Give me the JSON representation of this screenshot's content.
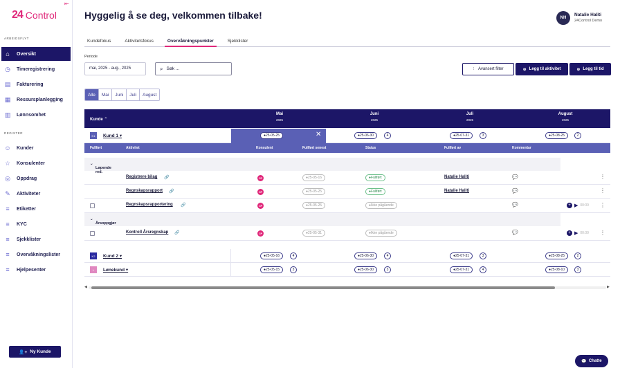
{
  "app": {
    "logo_mark": "24",
    "logo_text": "Control"
  },
  "sidebar": {
    "section_work": "ARBEIDSFLYT",
    "section_register": "REGISTER",
    "work_items": [
      {
        "label": "Oversikt",
        "icon": "home-icon",
        "active": true
      },
      {
        "label": "Timeregistrering",
        "icon": "clock-icon"
      },
      {
        "label": "Fakturering",
        "icon": "invoice-icon"
      },
      {
        "label": "Ressursplanlegging",
        "icon": "calendar-icon"
      },
      {
        "label": "Lønnsomhet",
        "icon": "chart-icon"
      }
    ],
    "register_items": [
      {
        "label": "Kunder",
        "icon": "user-icon"
      },
      {
        "label": "Konsulenter",
        "icon": "star-icon"
      },
      {
        "label": "Oppdrag",
        "icon": "task-icon"
      },
      {
        "label": "Aktiviteter",
        "icon": "activity-icon"
      },
      {
        "label": "Etiketter",
        "icon": "tag-icon"
      },
      {
        "label": "KYC",
        "icon": "kyc-icon"
      },
      {
        "label": "Sjekklister",
        "icon": "checklist-icon"
      },
      {
        "label": "Overvåkningslister",
        "icon": "watchlist-icon"
      },
      {
        "label": "Hjelpesenter",
        "icon": "help-icon"
      }
    ],
    "new_customer": "Ny Kunde"
  },
  "header": {
    "greeting": "Hyggelig å se deg, velkommen tilbake!",
    "avatar": "NH",
    "user_name": "Natalie Haliti",
    "user_org": "24Control Demo"
  },
  "tabs": [
    "Kundefokus",
    "Aktivitetsfokus",
    "Overvåkningspunkter",
    "Sjekklister"
  ],
  "active_tab": 2,
  "filters": {
    "period_label": "Periode",
    "period_value": "mai, 2025 - aug., 2025",
    "search_placeholder": "Søk ...",
    "advanced_filter": "Avansert filter",
    "add_activity": "Legg til aktivitet",
    "add_time": "Legg til tid"
  },
  "month_filter": [
    "Alle",
    "Mai",
    "Juni",
    "Juli",
    "August"
  ],
  "table": {
    "kunde_header": "Kunde",
    "months": [
      {
        "name": "Mai",
        "year": "2025"
      },
      {
        "name": "Juni",
        "year": "2025"
      },
      {
        "name": "Juli",
        "year": "2025"
      },
      {
        "name": "August",
        "year": "2025"
      }
    ],
    "customers": [
      {
        "tag": "K1",
        "tag_color": "#5a60b5",
        "name": "Kund 1",
        "chips": [
          {
            "date": "25-05-25",
            "count": ""
          },
          {
            "date": "25-06-30",
            "count": "4"
          },
          {
            "date": "25-07-31",
            "count": "3"
          },
          {
            "date": "25-08-25",
            "count": "2"
          }
        ]
      },
      {
        "tag": "K2",
        "tag_color": "#2a2aa0",
        "name": "Kund 2",
        "chips": [
          {
            "date": "25-05-16",
            "count": "4"
          },
          {
            "date": "25-06-30",
            "count": "4"
          },
          {
            "date": "25-07-31",
            "count": "3"
          },
          {
            "date": "25-08-25",
            "count": "2"
          }
        ]
      },
      {
        "tag": "L",
        "tag_color": "#e088c0",
        "name": "Lønekund",
        "chips": [
          {
            "date": "25-05-15",
            "count": "3"
          },
          {
            "date": "25-06-30",
            "count": "3"
          },
          {
            "date": "25-07-31",
            "count": "4"
          },
          {
            "date": "25-08-10",
            "count": "3"
          }
        ]
      }
    ],
    "sub_headers": [
      "Fullført",
      "Aktivitet",
      "Konsulent",
      "Fullført senest",
      "Status",
      "Fullført av",
      "Kommentar"
    ],
    "groups": [
      {
        "name": "Løpende red.",
        "activities": [
          {
            "name": "Registrere bilag",
            "consultant": "CP",
            "deadline": "25-05-16",
            "status": "Fullført",
            "done_by": "Natalie Haliti",
            "checkbox": false
          },
          {
            "name": "Regnskapsrapport",
            "consultant": "CP",
            "deadline": "25-05-25",
            "status": "Fullført",
            "done_by": "Natalie Haliti",
            "checkbox": false
          },
          {
            "name": "Regnskapsrapportering",
            "consultant": "CP",
            "deadline": "25-05-25",
            "status": "Ikke pågående",
            "done_by": "",
            "checkbox": true,
            "timer": "00:00"
          }
        ]
      },
      {
        "name": "Årsoppgjør",
        "activities": [
          {
            "name": "Kontroll Årsregnskap",
            "consultant": "CP",
            "deadline": "25-05-31",
            "status": "Ikke pågående",
            "done_by": "",
            "checkbox": true,
            "timer": "00:00"
          }
        ]
      }
    ]
  },
  "chat": "Chatte"
}
